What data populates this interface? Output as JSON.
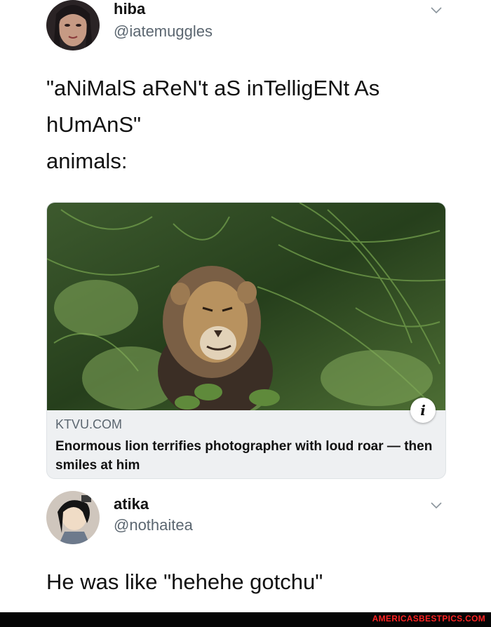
{
  "tweet1": {
    "name": "hiba",
    "handle": "@iatemuggles",
    "text_line1": "\"aNiMalS aReN't aS inTelligENt As",
    "text_line2": "hUmAnS\"",
    "text_line3": "animals:"
  },
  "card": {
    "domain": "KTVU.COM",
    "title": "Enormous lion terrifies photographer with loud roar — then smiles at him",
    "info_icon": "i"
  },
  "tweet2": {
    "name": "atika",
    "handle": "@nothaitea",
    "text": "He was like \"hehehe gotchu\""
  },
  "footer": {
    "watermark": "AMERICASBESTPICS.COM"
  },
  "colors": {
    "text": "#111111",
    "secondary": "#5b6670",
    "card_bg": "#eef0f2",
    "watermark": "#ff2222"
  }
}
